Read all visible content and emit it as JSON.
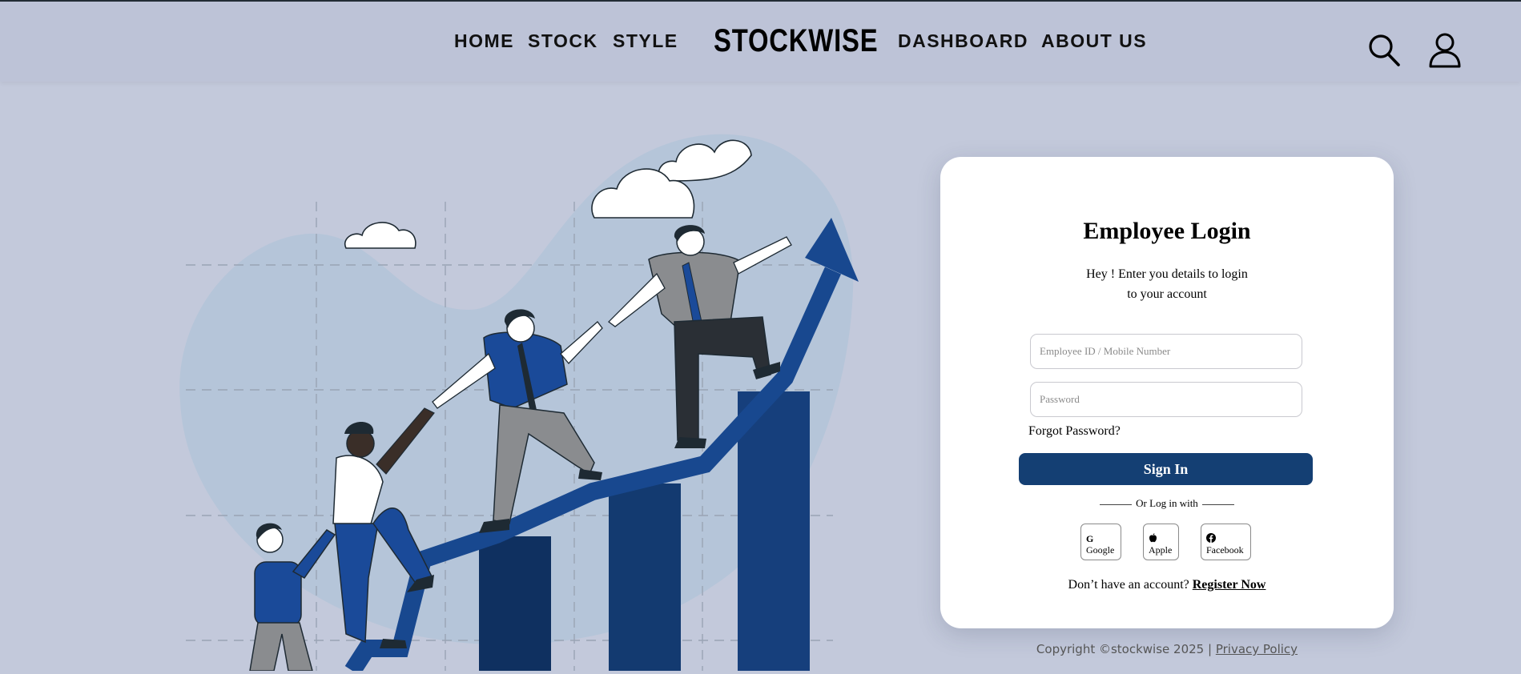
{
  "nav": {
    "left_links": [
      "HOME",
      "STOCK",
      "STYLE"
    ],
    "brand": "STOCKWISE",
    "right_links": [
      "DASHBOARD",
      "ABOUT US"
    ],
    "icons": [
      "search-icon",
      "user-icon"
    ]
  },
  "login": {
    "title": "Employee Login",
    "subtitle_line1": "Hey ! Enter you details to login",
    "subtitle_line2": "to your account",
    "id_placeholder": "Employee ID / Mobile Number",
    "password_placeholder": "Password",
    "forgot": "Forgot Password?",
    "sign_in": "Sign In",
    "or_login_with": "Or Log in with",
    "social": [
      {
        "label": "Google",
        "icon": "google-icon"
      },
      {
        "label": "Apple",
        "icon": "apple-icon"
      },
      {
        "label": "Facebook",
        "icon": "facebook-icon"
      }
    ],
    "no_account": "Don’t have an account?",
    "register": "Register Now"
  },
  "footer": {
    "copyright": "Copyright ©stockwise 2025 |",
    "privacy": "Privacy Policy"
  },
  "colors": {
    "background": "#c3c9db",
    "primary": "#143f73",
    "bar_dark": "#0f3060",
    "arrow": "#18488f"
  }
}
